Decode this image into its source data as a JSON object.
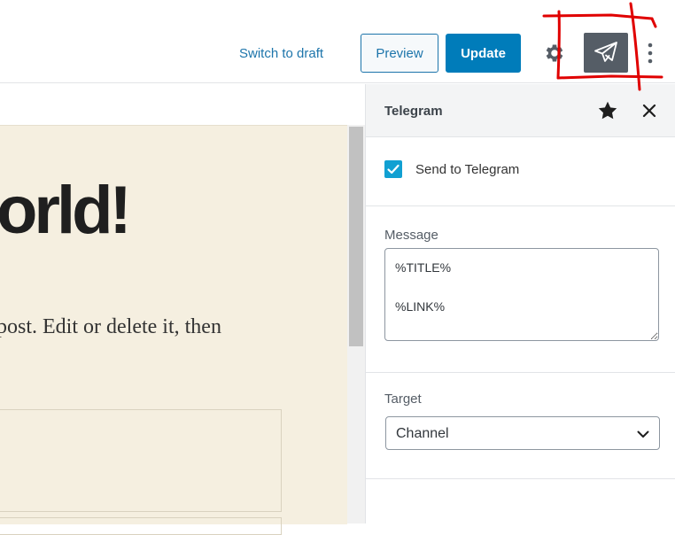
{
  "toolbar": {
    "switch_to_draft": "Switch to draft",
    "preview": "Preview",
    "update": "Update",
    "icons": [
      "gear-icon",
      "paper-plane-icon",
      "more-vertical-icon"
    ]
  },
  "editor": {
    "title_visible": "orld!",
    "paragraph_visible": "post. Edit or delete it, then"
  },
  "sidebar": {
    "title": "Telegram",
    "icons": [
      "star-icon",
      "close-icon"
    ],
    "send_to_telegram": {
      "label": "Send to Telegram",
      "checked": true
    },
    "message": {
      "label": "Message",
      "value": "%TITLE%\n\n%LINK%"
    },
    "target": {
      "label": "Target",
      "selected": "Channel"
    }
  },
  "colors": {
    "accent": "#007cba",
    "link": "#1d75ab",
    "checkbox": "#11a0d2",
    "annotation": "#e00000",
    "canvas": "#f5efe0"
  }
}
